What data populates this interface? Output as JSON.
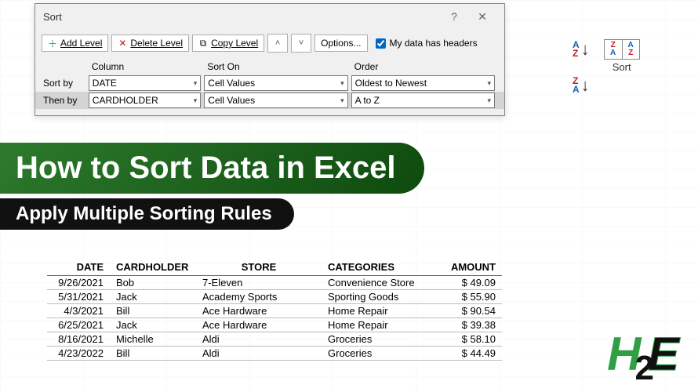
{
  "dialog": {
    "title": "Sort",
    "buttons": {
      "add": "Add Level",
      "delete": "Delete Level",
      "copy": "Copy Level",
      "options": "Options..."
    },
    "checkbox": "My data has headers",
    "checkbox_checked": true,
    "headers": {
      "column": "Column",
      "sorton": "Sort On",
      "order": "Order"
    },
    "rows": [
      {
        "label": "Sort by",
        "column": "DATE",
        "sorton": "Cell Values",
        "order": "Oldest to Newest"
      },
      {
        "label": "Then by",
        "column": "CARDHOLDER",
        "sorton": "Cell Values",
        "order": "A to Z"
      }
    ]
  },
  "ribbon": {
    "sort_asc": {
      "top": "A",
      "bot": "Z"
    },
    "sort_desc": {
      "top": "Z",
      "bot": "A"
    },
    "sort_label": "Sort"
  },
  "banner": {
    "title": "How to Sort Data in Excel",
    "subtitle": "Apply Multiple Sorting Rules"
  },
  "table": {
    "headers": [
      "DATE",
      "CARDHOLDER",
      "STORE",
      "CATEGORIES",
      "AMOUNT"
    ],
    "rows": [
      [
        "9/26/2021",
        "Bob",
        "7-Eleven",
        "Convenience Store",
        "$  49.09"
      ],
      [
        "5/31/2021",
        "Jack",
        "Academy Sports",
        "Sporting Goods",
        "$  55.90"
      ],
      [
        "4/3/2021",
        "Bill",
        "Ace Hardware",
        "Home Repair",
        "$  90.54"
      ],
      [
        "6/25/2021",
        "Jack",
        "Ace Hardware",
        "Home Repair",
        "$  39.38"
      ],
      [
        "8/16/2021",
        "Michelle",
        "Aldi",
        "Groceries",
        "$  58.10"
      ],
      [
        "4/23/2022",
        "Bill",
        "Aldi",
        "Groceries",
        "$  44.49"
      ]
    ]
  },
  "logo": {
    "h": "H",
    "two": "2",
    "e": "E"
  }
}
